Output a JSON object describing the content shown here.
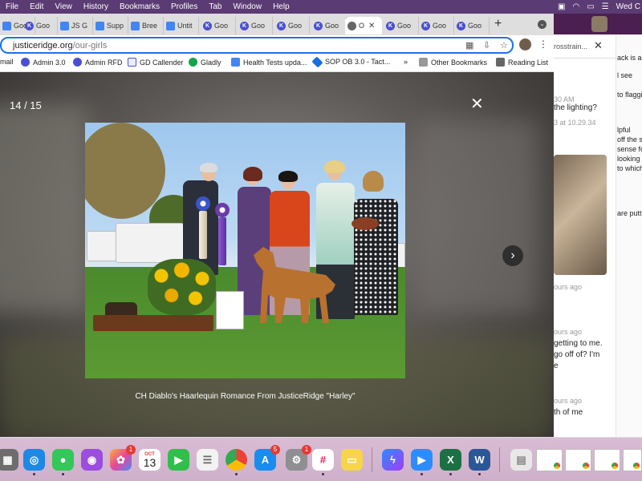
{
  "menubar": {
    "items": [
      "File",
      "Edit",
      "View",
      "History",
      "Bookmarks",
      "Profiles",
      "Tab",
      "Window",
      "Help"
    ],
    "clock": "Wed C"
  },
  "browser": {
    "tabs": [
      {
        "title": "Goo",
        "icon": "doc-icon"
      },
      {
        "title": "Goo",
        "icon": "k-icon"
      },
      {
        "title": "JS G",
        "icon": "doc-icon"
      },
      {
        "title": "Supp",
        "icon": "doc-icon"
      },
      {
        "title": "Bree",
        "icon": "doc-icon"
      },
      {
        "title": "Untit",
        "icon": "doc-icon"
      },
      {
        "title": "Goo",
        "icon": "k-icon"
      },
      {
        "title": "Goo",
        "icon": "k-icon"
      },
      {
        "title": "Goo",
        "icon": "k-icon"
      },
      {
        "title": "Goo",
        "icon": "k-icon"
      },
      {
        "title": "O",
        "icon": "globe-icon",
        "active": true
      },
      {
        "title": "Goo",
        "icon": "k-icon"
      },
      {
        "title": "Goo",
        "icon": "k-icon"
      },
      {
        "title": "Goo",
        "icon": "k-icon"
      }
    ],
    "url_host": "justiceridge.org",
    "url_path": "/our-girls",
    "bookmarks": [
      {
        "label": "mail",
        "icon": "none"
      },
      {
        "label": "Admin 3.0",
        "icon": "k-icon"
      },
      {
        "label": "Admin RFD",
        "icon": "k-icon"
      },
      {
        "label": "GD Callender",
        "icon": "gd-icon"
      },
      {
        "label": "Gladly",
        "icon": "plus-circle-icon"
      },
      {
        "label": "Health Tests upda...",
        "icon": "doc-icon"
      },
      {
        "label": "SOP OB 3.0 - Tact...",
        "icon": "sop-icon"
      },
      {
        "label": "»",
        "icon": "none"
      },
      {
        "label": "Other Bookmarks",
        "icon": "folder-icon"
      },
      {
        "label": "Reading List",
        "icon": "list-icon"
      }
    ]
  },
  "lightbox": {
    "counter": "14 / 15",
    "close_glyph": "✕",
    "next_glyph": "›",
    "caption": "CH Diablo's Haarlequin Romance From JusticeRidge \"Harley\""
  },
  "bg_chat": {
    "header": "rosstrain...",
    "lines": [
      {
        "text": "ack is a h",
        "muted": false
      },
      {
        "text": "l see",
        "muted": false
      },
      {
        "text": "30 AM",
        "muted": true
      },
      {
        "text": "the lighting?",
        "muted": false
      },
      {
        "text": "to flaggi",
        "muted": false
      },
      {
        "text": "3 at 10.29.34",
        "muted": true
      },
      {
        "text": "lpful",
        "muted": false
      },
      {
        "text": "off the s",
        "muted": false
      },
      {
        "text": "sense fo",
        "muted": false
      },
      {
        "text": "looking f",
        "muted": false
      },
      {
        "text": "to which",
        "muted": false
      },
      {
        "text": "are puttin",
        "muted": false
      },
      {
        "text": "ours ago",
        "muted": true
      },
      {
        "text": "ours ago",
        "muted": true
      },
      {
        "text": "getting to me.",
        "muted": false
      },
      {
        "text": "go off of? I'm",
        "muted": false
      },
      {
        "text": "e",
        "muted": false
      },
      {
        "text": "ours ago",
        "muted": true
      },
      {
        "text": "th of me",
        "muted": false
      }
    ]
  },
  "dock": {
    "apps": [
      {
        "name": "launchpad-icon",
        "color": "#6d6d6d",
        "badge": ""
      },
      {
        "name": "safari-icon",
        "color": "#1e88e5",
        "badge": ""
      },
      {
        "name": "messages-icon",
        "color": "#34c759",
        "badge": ""
      },
      {
        "name": "podcasts-icon",
        "color": "#9b4de0",
        "badge": ""
      },
      {
        "name": "photos-icon",
        "color": "#f0a030",
        "badge": "1"
      },
      {
        "name": "calendar-icon",
        "color": "#ffffff",
        "badge": ""
      },
      {
        "name": "facetime-icon",
        "color": "#2fbf4a",
        "badge": ""
      },
      {
        "name": "reminders-icon",
        "color": "#f2f2f2",
        "badge": ""
      },
      {
        "name": "chrome-icon",
        "color": "#ffffff",
        "badge": ""
      },
      {
        "name": "app-store-icon",
        "color": "#1a8cf0",
        "badge": "5"
      },
      {
        "name": "system-preferences-icon",
        "color": "#8e8e93",
        "badge": "1"
      },
      {
        "name": "slack-icon",
        "color": "#ffffff",
        "badge": ""
      },
      {
        "name": "notes-icon",
        "color": "#f7d54a",
        "badge": ""
      },
      {
        "name": "messenger-icon",
        "color": "#8a5cf6",
        "badge": ""
      },
      {
        "name": "zoom-icon",
        "color": "#2d8cff",
        "badge": ""
      },
      {
        "name": "excel-icon",
        "color": "#1d7044",
        "badge": ""
      },
      {
        "name": "word-icon",
        "color": "#2b5797",
        "badge": ""
      }
    ],
    "calendar": {
      "month": "OCT",
      "day": "13"
    }
  }
}
